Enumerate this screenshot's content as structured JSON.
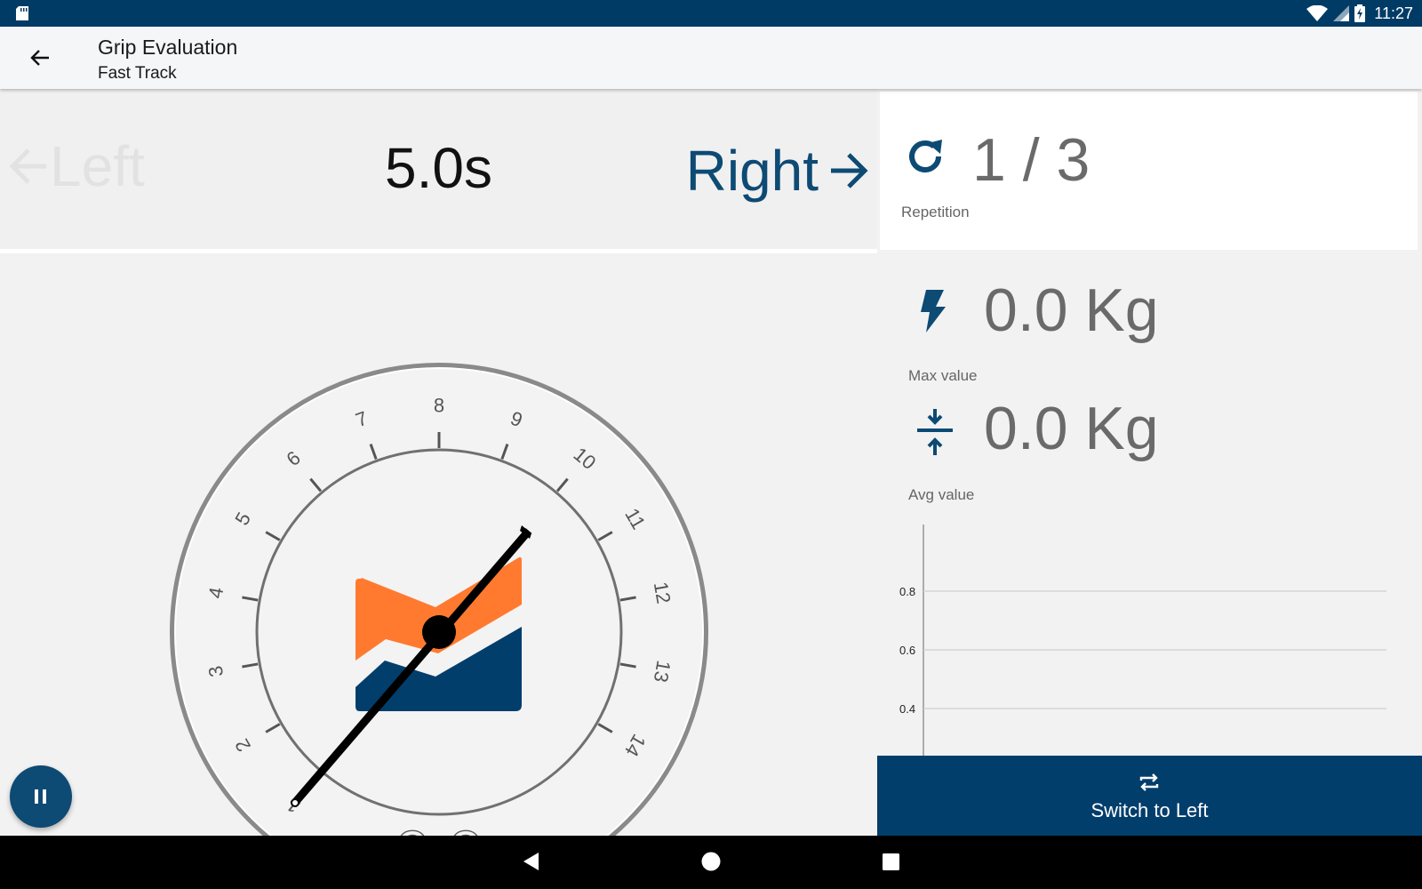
{
  "status_bar": {
    "time": "11:27",
    "icons": [
      "sd-card-icon",
      "wifi-icon",
      "signal-icon",
      "battery-charging-icon"
    ]
  },
  "app_bar": {
    "title": "Grip Evaluation",
    "subtitle": "Fast Track",
    "back_icon": "arrow-back-icon"
  },
  "session": {
    "left_label": "Left",
    "right_label": "Right",
    "timer": "5.0s",
    "active_side": "Right"
  },
  "gauge": {
    "ticks": [
      "1",
      "2",
      "3",
      "4",
      "5",
      "6",
      "7",
      "8",
      "9",
      "10",
      "11",
      "12",
      "13",
      "14"
    ],
    "reading": "0.0",
    "logo_colors": {
      "orange": "#ff7a2f",
      "navy": "#023e6c"
    }
  },
  "repetition": {
    "value": "1 / 3",
    "label": "Repetition",
    "icon": "refresh-icon"
  },
  "max_stat": {
    "value": "0.0 Kg",
    "label": "Max value",
    "icon": "flash-icon"
  },
  "avg_stat": {
    "value": "0.0 Kg",
    "label": "Avg value",
    "icon": "compress-icon"
  },
  "chart_data": {
    "type": "line",
    "y_ticks": [
      "0.8",
      "0.6",
      "0.4"
    ],
    "ylim": [
      0.4,
      0.8
    ],
    "grid": true,
    "series": []
  },
  "switch_button": {
    "label": "Switch to Left",
    "icon": "repeat-icon"
  },
  "nav_bar": {
    "buttons": [
      "back-triangle-icon",
      "home-circle-icon",
      "recents-square-icon"
    ]
  },
  "colors": {
    "primary": "#023e6c",
    "accent": "#ff7a2f",
    "background": "#f2f2f2"
  }
}
